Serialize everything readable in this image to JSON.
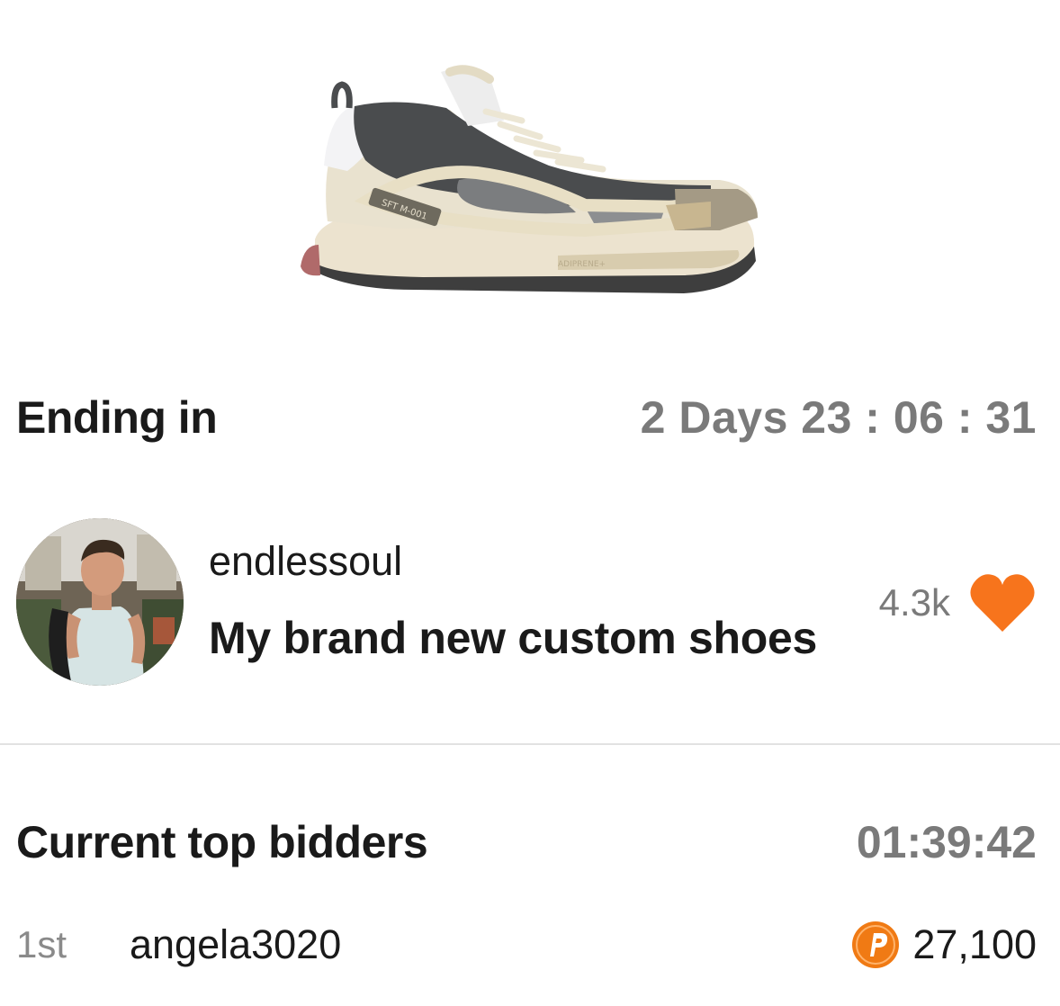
{
  "auction": {
    "ending_label": "Ending in",
    "countdown": "2 Days 23 : 06 : 31"
  },
  "seller": {
    "username": "endlessoul",
    "listing_title": "My brand new custom shoes",
    "likes": "4.3k"
  },
  "bidding": {
    "label": "Current top bidders",
    "timer": "01:39:42",
    "bidders": [
      {
        "rank": "1st",
        "name": "angela3020",
        "amount": "27,100"
      }
    ]
  },
  "product_image": {
    "shoe_tag_text": "SFT M-001",
    "sole_text": "ADIPRENE+"
  },
  "colors": {
    "accent": "#f7741c",
    "coin": "#f07a14",
    "muted_text": "#7a7a7a",
    "divider": "#e2e2e2"
  },
  "icons": {
    "like": "heart-icon",
    "currency": "points-coin-icon"
  }
}
